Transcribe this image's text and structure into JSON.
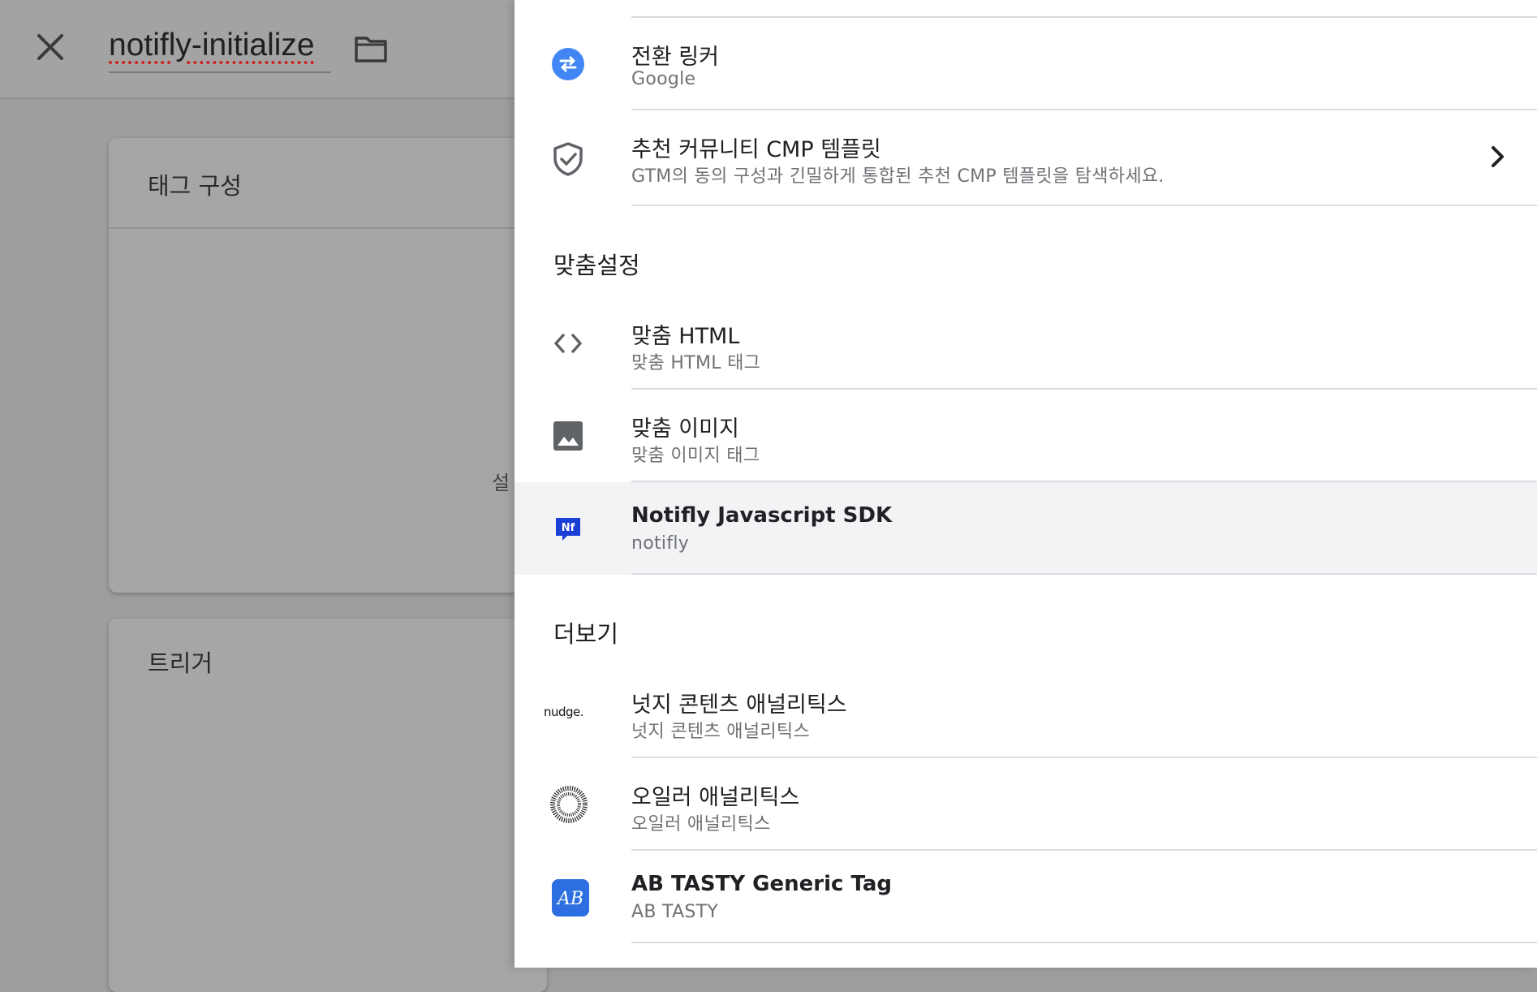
{
  "editor": {
    "tag_name": "notifly-initialize",
    "card_tag_config_title": "태그 구성",
    "card_tag_config_hint": "설",
    "card_trigger_title": "트리거"
  },
  "panel": {
    "top_items": [
      {
        "label": "전환 링커",
        "sub": "Google",
        "icon": "conversion-linker-icon"
      },
      {
        "label": "추천 커뮤니티 CMP 템플릿",
        "sub": "GTM의 동의 구성과 긴밀하게 통합된 추천 CMP 템플릿을 탐색하세요.",
        "icon": "shield-check-icon"
      }
    ],
    "custom_section": "맞춤설정",
    "custom_items": [
      {
        "label": "맞춤 HTML",
        "sub": "맞춤 HTML 태그",
        "icon": "code-icon"
      },
      {
        "label": "맞춤 이미지",
        "sub": "맞춤 이미지 태그",
        "icon": "image-icon"
      },
      {
        "label": "Notifly Javascript SDK",
        "sub": "notifly",
        "icon": "notifly-logo-icon"
      }
    ],
    "more_section": "더보기",
    "more_items": [
      {
        "label": "넛지 콘텐츠 애널리틱스",
        "sub": "넛지 콘텐츠 애널리틱스",
        "icon": "nudge-logo-icon",
        "logo_text": "nudge."
      },
      {
        "label": "오일러 애널리틱스",
        "sub": "오일러 애널리틱스",
        "icon": "euler-logo-icon"
      },
      {
        "label": "AB TASTY Generic Tag",
        "sub": "AB TASTY",
        "icon": "abtasty-logo-icon",
        "logo_text": "AB"
      }
    ],
    "accent_color": "#4285f4",
    "notifly_color": "#1a3fd6"
  }
}
